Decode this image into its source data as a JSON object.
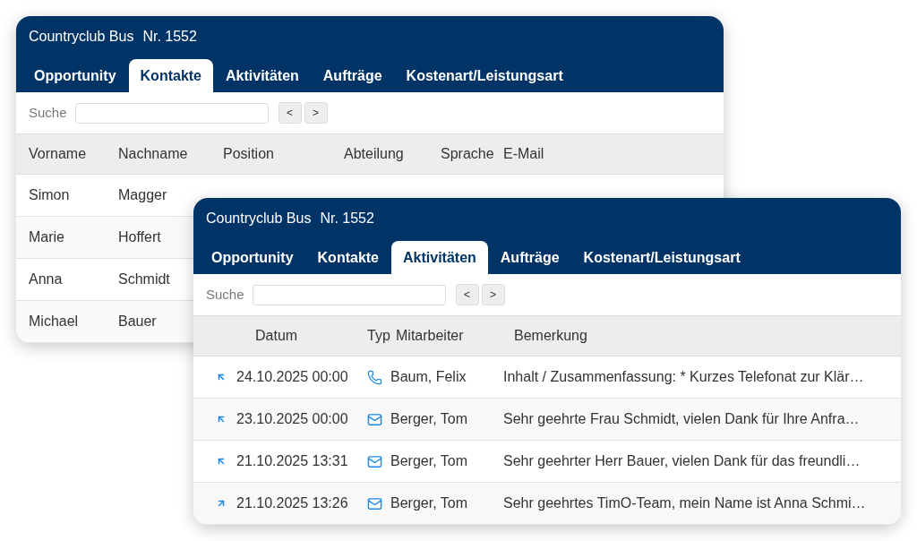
{
  "windows": [
    {
      "title": "Countryclub Bus",
      "number": "Nr. 1552",
      "tabs": [
        {
          "label": "Opportunity",
          "selected": false
        },
        {
          "label": "Kontakte",
          "selected": true
        },
        {
          "label": "Aktivitäten",
          "selected": false
        },
        {
          "label": "Aufträge",
          "selected": false
        },
        {
          "label": "Kostenart/Leistungsart",
          "selected": false
        }
      ],
      "search": {
        "label": "Suche",
        "prev": "<",
        "next": ">"
      },
      "kind": "contacts",
      "table": {
        "columns": [
          "Vorname",
          "Nachname",
          "Position",
          "Abteilung",
          "Sprache",
          "E-Mail"
        ],
        "rows": [
          {
            "cells": [
              "Simon",
              "Magger"
            ]
          },
          {
            "cells": [
              "Marie",
              "Hoffert"
            ]
          },
          {
            "cells": [
              "Anna",
              "Schmidt"
            ]
          },
          {
            "cells": [
              "Michael",
              "Bauer"
            ]
          }
        ]
      }
    },
    {
      "title": "Countryclub Bus",
      "number": "Nr. 1552",
      "tabs": [
        {
          "label": "Opportunity",
          "selected": false
        },
        {
          "label": "Kontakte",
          "selected": false
        },
        {
          "label": "Aktivitäten",
          "selected": true
        },
        {
          "label": "Aufträge",
          "selected": false
        },
        {
          "label": "Kostenart/Leistungsart",
          "selected": false
        }
      ],
      "search": {
        "label": "Suche",
        "prev": "<",
        "next": ">"
      },
      "kind": "activities",
      "table": {
        "columns": [
          "Datum",
          "Typ",
          "Mitarbeiter",
          "Bemerkung"
        ],
        "rows": [
          {
            "incoming": true,
            "kind": "phone",
            "cells": [
              "24.10.2025 00:00",
              "",
              "Baum, Felix",
              "Inhalt / Zusammenfassung: * Kurzes Telefonat zur Klär…"
            ]
          },
          {
            "incoming": true,
            "kind": "mail",
            "cells": [
              "23.10.2025 00:00",
              "",
              "Berger, Tom",
              "Sehr geehrte Frau Schmidt, vielen Dank für Ihre Anfra…"
            ]
          },
          {
            "incoming": true,
            "kind": "mail",
            "cells": [
              "21.10.2025 13:31",
              "",
              "Berger, Tom",
              "Sehr geehrter Herr Bauer, vielen Dank für das freundli…"
            ]
          },
          {
            "incoming": false,
            "kind": "mail",
            "cells": [
              "21.10.2025 13:26",
              "",
              "Berger, Tom",
              "Sehr geehrtes TimO-Team, mein Name ist Anna Schmi…"
            ]
          }
        ]
      }
    }
  ]
}
